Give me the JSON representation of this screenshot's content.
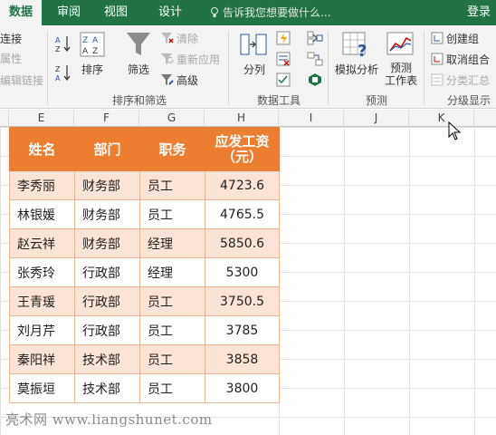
{
  "tabs": [
    {
      "label": "数据",
      "active": true
    },
    {
      "label": "审阅",
      "active": false
    },
    {
      "label": "视图",
      "active": false
    },
    {
      "label": "设计",
      "active": false
    }
  ],
  "tell_me_placeholder": "告诉我您想要做什么...",
  "login_label": "登录",
  "ribbon": {
    "left_cut": {
      "connect": "连接",
      "properties": "属性",
      "edit_links": "编辑链接"
    },
    "sort_filter": {
      "sort_label": "排序",
      "filter_label": "筛选",
      "clear_label": "清除",
      "reapply_label": "重新应用",
      "advanced_label": "高级",
      "group_label": "排序和筛选"
    },
    "data_tools": {
      "split_label": "分列",
      "group_label": "数据工具"
    },
    "forecast": {
      "whatif_label": "模拟分析",
      "forecast_sheet_label": "预测\n工作表",
      "group_label": "预测"
    },
    "outline": {
      "group_btn": "创建组",
      "ungroup_btn": "取消组合",
      "subtotal_btn": "分类汇总",
      "group_label": "分级显示"
    }
  },
  "columns": [
    "E",
    "F",
    "G",
    "H",
    "I",
    "J",
    "K"
  ],
  "table": {
    "headers": [
      "姓名",
      "部门",
      "职务",
      "应发工资\n（元）"
    ],
    "rows": [
      [
        "李秀丽",
        "财务部",
        "员工",
        "4723.6"
      ],
      [
        "林银媛",
        "财务部",
        "员工",
        "4765.5"
      ],
      [
        "赵云祥",
        "财务部",
        "经理",
        "5850.6"
      ],
      [
        "张秀玲",
        "行政部",
        "经理",
        "5300"
      ],
      [
        "王青瑗",
        "行政部",
        "员工",
        "3750.5"
      ],
      [
        "刘月芹",
        "行政部",
        "员工",
        "3785"
      ],
      [
        "秦阳祥",
        "技术部",
        "员工",
        "3858"
      ],
      [
        "莫振垣",
        "技术部",
        "员工",
        "3800"
      ]
    ]
  },
  "watermark": "亮术网 www.liangshunet.com",
  "colors": {
    "ribbon_green": "#217346",
    "header_orange": "#ed7d31",
    "band_orange": "#fbe4d5"
  }
}
